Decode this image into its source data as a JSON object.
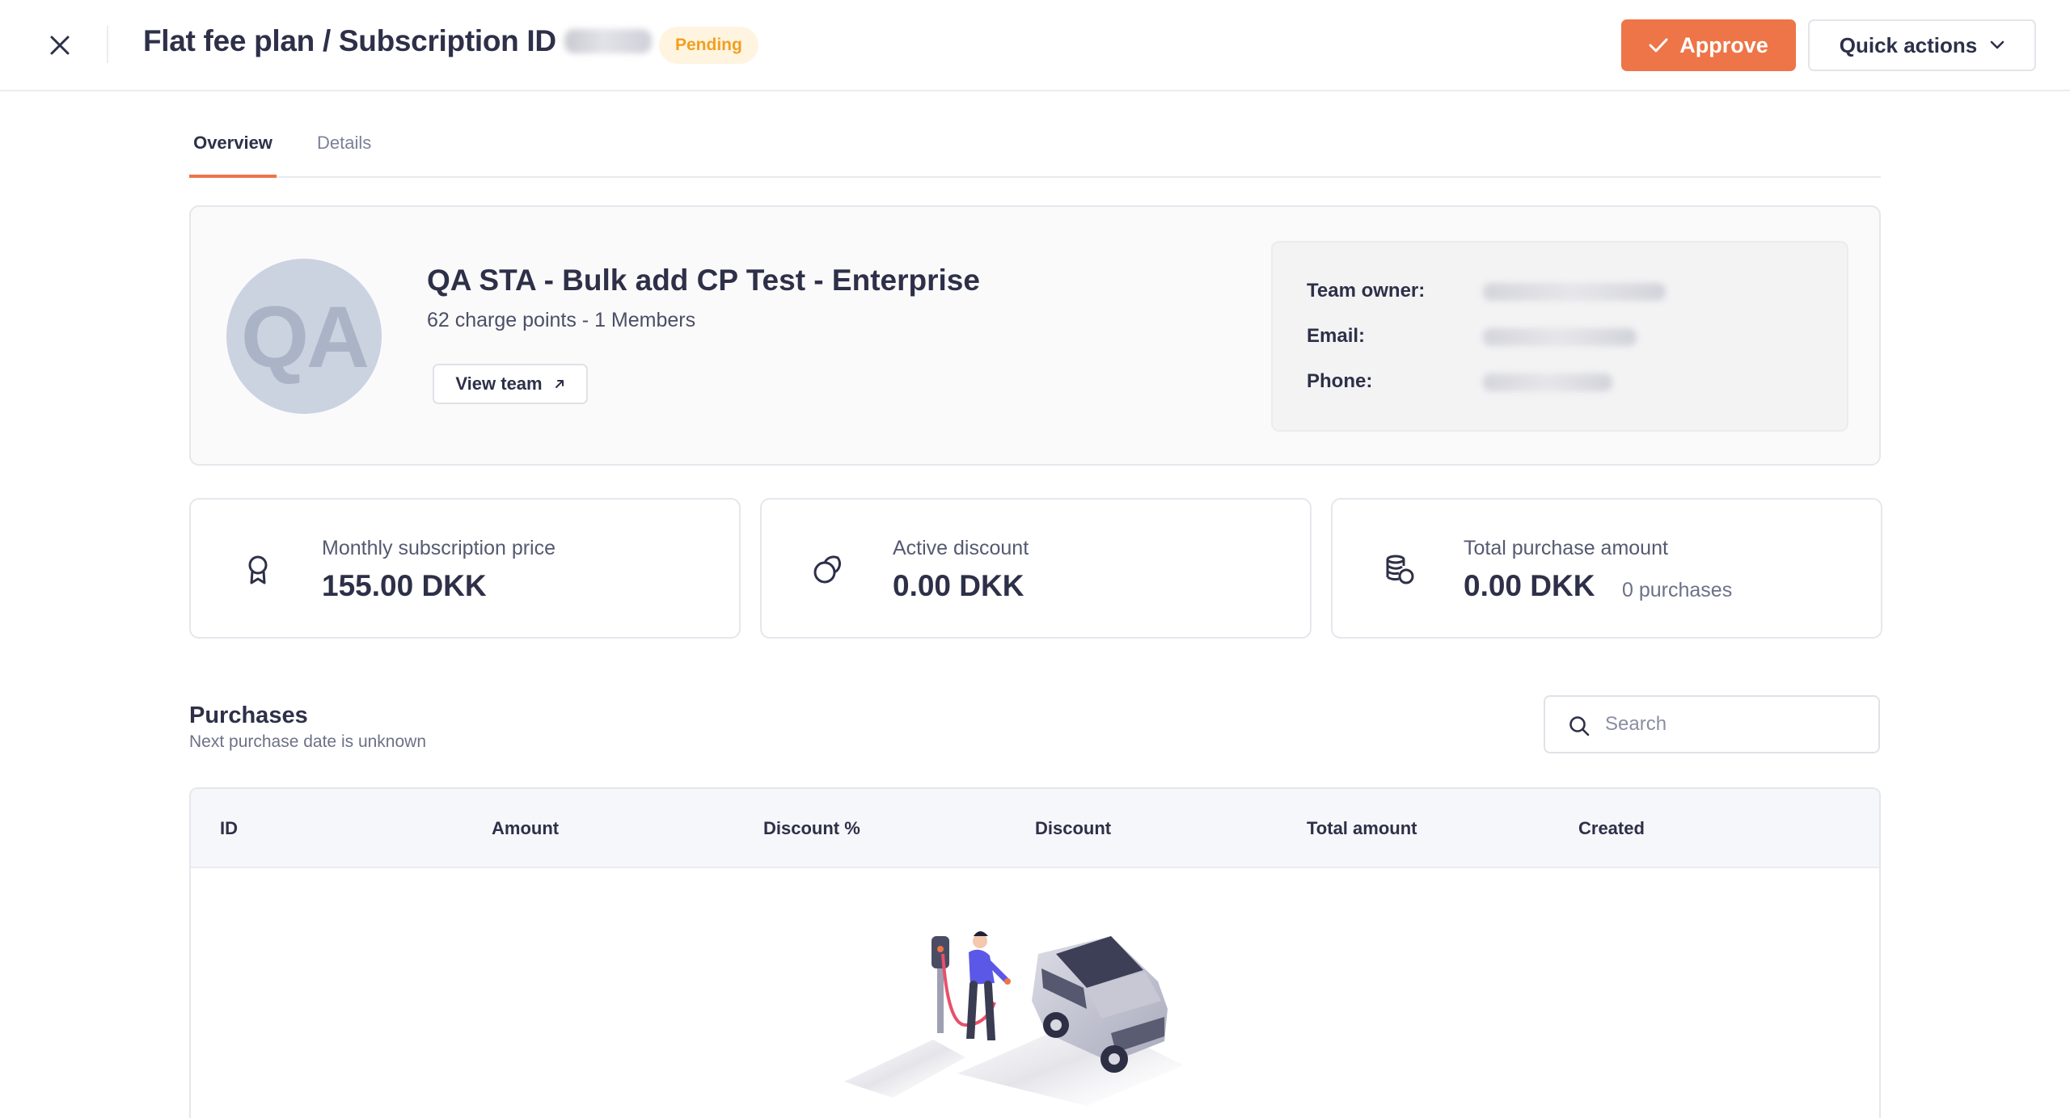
{
  "header": {
    "title": "Flat fee plan / Subscription ID",
    "status": "Pending",
    "approve_label": "Approve",
    "quick_actions_label": "Quick actions",
    "colors": {
      "accent": "#ed7547",
      "pending_text": "#f0a020",
      "pending_bg": "#fff4e0"
    }
  },
  "tabs": [
    {
      "label": "Overview",
      "active": true
    },
    {
      "label": "Details",
      "active": false
    }
  ],
  "team": {
    "avatar_initials": "QA",
    "name": "QA STA - Bulk add CP Test - Enterprise",
    "summary": "62 charge points - 1 Members",
    "view_team_label": "View team",
    "owner_labels": {
      "owner": "Team owner:",
      "email": "Email:",
      "phone": "Phone:"
    }
  },
  "stats": [
    {
      "icon": "award-icon",
      "label": "Monthly subscription price",
      "value": "155.00 DKK",
      "extra": ""
    },
    {
      "icon": "discount-circles-icon",
      "label": "Active discount",
      "value": "0.00 DKK",
      "extra": ""
    },
    {
      "icon": "coins-stack-icon",
      "label": "Total purchase amount",
      "value": "0.00 DKK",
      "extra": "0 purchases"
    }
  ],
  "purchases": {
    "title": "Purchases",
    "subtitle": "Next purchase date is unknown",
    "search_placeholder": "Search",
    "columns": [
      "ID",
      "Amount",
      "Discount %",
      "Discount",
      "Total amount",
      "Created"
    ],
    "rows": []
  }
}
